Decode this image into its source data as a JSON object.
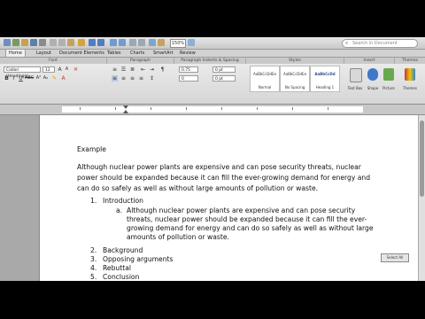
{
  "search": {
    "placeholder": "Search in Document"
  },
  "zoom": "150%",
  "tabs": [
    "Home",
    "Layout",
    "Document Elements",
    "Tables",
    "Charts",
    "SmartArt",
    "Review"
  ],
  "ribbon": {
    "groups": [
      "Font",
      "Paragraph",
      "Paragraph Indents & Spacing",
      "Styles",
      "Insert",
      "Themes"
    ],
    "font_name": "Calibri (Headings)",
    "font_size": "12",
    "indent_left": "0.75",
    "indent_right": "0",
    "spacing_before": "0 pt",
    "spacing_after": "0 pt",
    "styles": [
      {
        "sample": "AaBbCcDdEe",
        "name": "Normal"
      },
      {
        "sample": "AaBbCcDdEe",
        "name": "No Spacing"
      },
      {
        "sample": "AaBbCcDd",
        "name": "Heading 1"
      }
    ],
    "buttons": [
      "Text Box",
      "Shape",
      "Picture",
      "Themes"
    ]
  },
  "document": {
    "heading": "Example",
    "thesis_lines": [
      "Although nuclear power plants are expensive and can pose security threats, nuclear",
      "power should be expanded because it can fill the ever-growing demand for energy and",
      "can do so safely as well as without large amounts of pollution or waste."
    ],
    "outline": [
      {
        "num": "1.",
        "text": "Introduction"
      },
      {
        "num": "2.",
        "text": "Background"
      },
      {
        "num": "3.",
        "text": "Opposing arguments"
      },
      {
        "num": "4.",
        "text": "Rebuttal"
      },
      {
        "num": "5.",
        "text": "Conclusion"
      }
    ],
    "sub": {
      "letter": "a.",
      "lines": [
        "Although nuclear power plants are expensive and can pose security",
        "threats, nuclear power should be expanded because it can fill the ever-",
        "growing demand for energy and can do so safely as well as without large",
        "amounts of pollution or waste."
      ]
    }
  },
  "status_label": "Select All"
}
